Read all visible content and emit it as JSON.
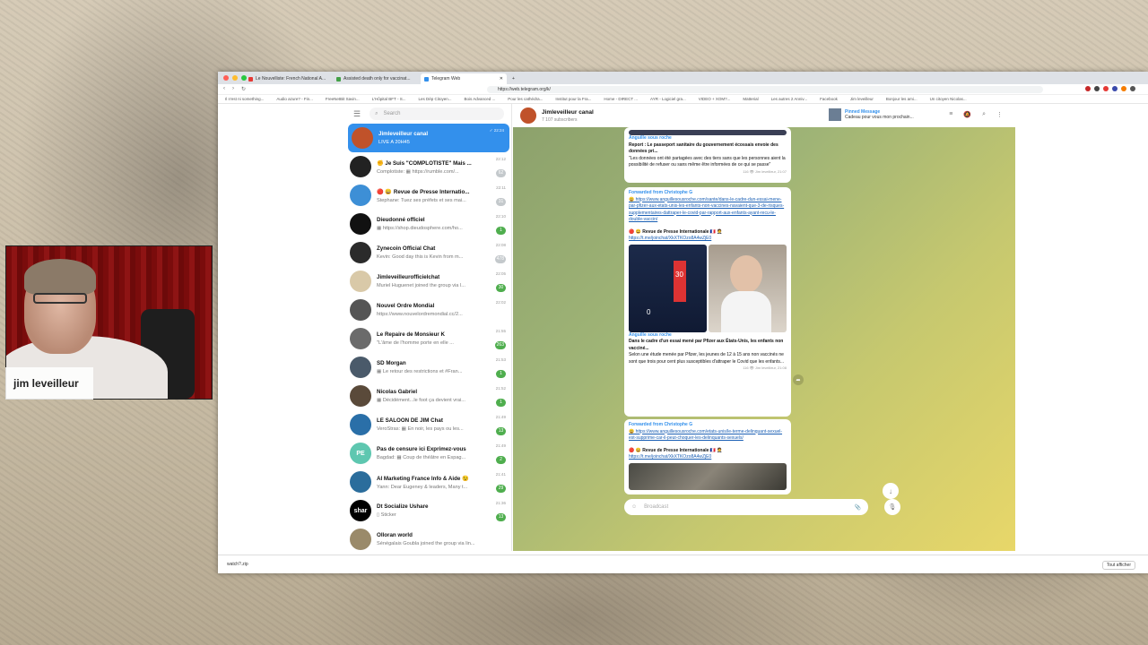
{
  "browser": {
    "tabs": [
      {
        "label": "Le Nouvelliste: French National A...",
        "color": "#e53935"
      },
      {
        "label": "Assisted death only for vaccinat...",
        "color": "#43a047"
      },
      {
        "label": "Telegram Web",
        "color": "#3390ec"
      }
    ],
    "url": "https://web.telegram.org/k/",
    "bookmarks": [
      "Il n'est ni something...",
      "Audio azure? - Fin...",
      "FreeNetBit Savin...",
      "L'Hôpital BFT - S...",
      "Les Dép Citoyen...",
      "Bois Advanced ...",
      "Pour les cathédra...",
      "Institut pour la Fra...",
      "Home - DIRECT ...",
      "AYR - Logiciel gra...",
      "VIDEO + XOM?...",
      "Matterial",
      "Les autres 2 Anniv...",
      "Facebook",
      "Jim leveilleur",
      "Bonjour les ami...",
      "Un citoyen Nicolas..."
    ],
    "download_item": "watch?.zip",
    "download_all": "Tout afficher"
  },
  "sidebar": {
    "search_placeholder": "Search",
    "chats": [
      {
        "name": "Jimleveilleur canal",
        "preview": "LIVE A 20H45",
        "time": "✓ 22:24",
        "badge": "",
        "avatar_color": "#c0522a",
        "active": true
      },
      {
        "name": "✊ Je Suis \"COMPLOTISTE\" Mais ...",
        "preview": "Complotiste: ▦ https://rumble.com/...",
        "time": "22:12",
        "badge": "62",
        "badge_type": "grey",
        "avatar_color": "#222222"
      },
      {
        "name": "🔴 😀 Revue de Presse Internatio...",
        "preview": "Stephane: Tuez ses préfets et ses mai...",
        "time": "22:11",
        "badge": "31",
        "badge_type": "grey",
        "avatar_color": "#3d8fd6"
      },
      {
        "name": "Dieudonné officiel",
        "preview": "▦ https://shop.dieudosphere.com/ho...",
        "time": "22:10",
        "badge": "1",
        "badge_type": "green",
        "avatar_color": "#111111"
      },
      {
        "name": "Zynecoin Official Chat",
        "preview": "Kevin: Good day this is Kevin from m...",
        "time": "22:08",
        "badge": "478",
        "badge_type": "grey",
        "avatar_color": "#2b2b2b"
      },
      {
        "name": "Jimleveilleurofficielchat",
        "preview": "Muriel Huguenet joined the group via l...",
        "time": "22:05",
        "badge": "30",
        "badge_type": "green",
        "avatar_color": "#d9c9a8"
      },
      {
        "name": "Nouvel Ordre Mondial",
        "preview": "https://www.nouvelordremondial.cc/2...",
        "time": "22:02",
        "badge": "",
        "avatar_color": "#555555"
      },
      {
        "name": "Le Repaire de Monsieur K",
        "preview": "\"L'âme de l'homme porte en elle ...",
        "time": "21:55",
        "badge": "263",
        "badge_type": "green",
        "avatar_color": "#6b6b6b"
      },
      {
        "name": "SD Morgan",
        "preview": "▦ Le retour des restrictions et #Fran...",
        "time": "21:53",
        "badge": "1",
        "badge_type": "green",
        "avatar_color": "#4a5a6a"
      },
      {
        "name": "Nicolas Gabriel",
        "preview": "▦ Décidément...le foot ça devient vrai...",
        "time": "21:52",
        "badge": "1",
        "badge_type": "green",
        "avatar_color": "#5a4a3a"
      },
      {
        "name": "LE SALOON DE JIM Chat",
        "preview": "VeroStras: ▦ En noir, les pays ou les...",
        "time": "21:49",
        "badge": "13",
        "badge_type": "green",
        "avatar_color": "#2a6fa8"
      },
      {
        "name": "Pas de censure ici Exprimez-vous",
        "preview": "Bagdad: ▦ Coup de théâtre en Espag...",
        "time": "21:49",
        "badge": "2",
        "badge_type": "green",
        "avatar_color": "#5ec7b0",
        "initials": "PE"
      },
      {
        "name": "AI Marketing France Info & Aide 😉",
        "preview": "Yann: Dear Eugeney & leaders, Many t...",
        "time": "21:41",
        "badge": "29",
        "badge_type": "green",
        "avatar_color": "#2b6d9c"
      },
      {
        "name": "Dt Socialize Ushare",
        "preview": "▯ Sticker",
        "time": "21:36",
        "badge": "13",
        "badge_type": "green",
        "avatar_color": "#000000",
        "initials": "shar"
      },
      {
        "name": "Olloran world",
        "preview": "Sénégalais Goubla joined the group via lin...",
        "time": "",
        "badge": "",
        "avatar_color": "#9a8a6a"
      }
    ]
  },
  "channel": {
    "title": "Jimleveilleur canal",
    "subscribers": "7 107 subscribers",
    "pinned_title": "Pinned Message",
    "pinned_preview": "Cadeau pour vous mon prochain...",
    "composer_placeholder": "Broadcast"
  },
  "messages": {
    "m1": {
      "source": "Anguille sous roche",
      "title": "Report : Le passeport sanitaire du gouvernement écossais envoie des données pri...",
      "text": "\"Les données ont été partagées avec des tiers sans que les personnes aient la possibilité de refuser ou sans même être informées de ce qui se passe\"",
      "meta": "116 👁 Jim leveilleur, 21:07"
    },
    "m2": {
      "forwarded": "Forwarded from Christophe G",
      "link": "😀 https://www.anguillesousroche.com/sante/dans-le-cadre-dun-essai-mene-par-pfizer-aux-etats-unis-les-enfants-non-vaccines-navaient-que-3-de-risques-supplementaires-dattraper-le-covid-par-rapport-aux-enfants-ayant-recu-le-double-vaccin/",
      "sender": "🔴 😀 Revue de Presse Internationale 🇫🇷 🤵",
      "sender_link": "https://t.me/joinchat/XkXTKOzo8A4wZjE0",
      "image_value_top": "30",
      "image_value_bottom": "0",
      "source": "Anguille sous roche",
      "title": "Dans le cadre d'un essai mené par Pfizer aux États-Unis, les enfants non vacciné...",
      "text": "Selon une étude menée par Pfizer, les jeunes de 12 à 15 ans non vaccinés ne sont que trois pour cent plus susceptibles d'attraper le Covid que les enfants...",
      "meta": "116 👁 Jim leveilleur, 21:08"
    },
    "m3": {
      "forwarded": "Forwarded from Christophe G",
      "link": "😀 https://www.anguillesousroche.com/etats-unis/le-terme-delinquant-sexuel-est-supprime-car-il-peut-choquer-les-delinquants-sexuels/",
      "sender": "🔴 😀 Revue de Presse Internationale 🇫🇷 🤵",
      "sender_link": "https://t.me/joinchat/XkXTKOzo8A4wZjE0"
    }
  },
  "overlay": {
    "streamer_name": "jim leveilleur"
  }
}
